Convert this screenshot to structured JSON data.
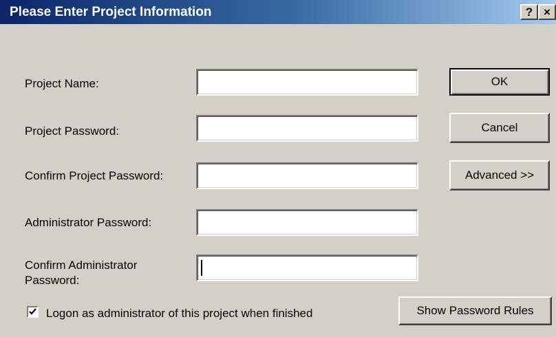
{
  "dialog": {
    "title": "Please Enter Project Information",
    "help_label": "?",
    "close_label": "×"
  },
  "fields": {
    "project_name": {
      "label": "Project Name:",
      "value": ""
    },
    "project_password": {
      "label": "Project Password:",
      "value": ""
    },
    "confirm_project_password": {
      "label": "Confirm Project Password:",
      "value": ""
    },
    "administrator_password": {
      "label": "Administrator Password:",
      "value": ""
    },
    "confirm_administrator_password": {
      "label_line1": "Confirm Administrator",
      "label_line2": "Password:",
      "value": ""
    }
  },
  "buttons": {
    "ok": "OK",
    "cancel": "Cancel",
    "advanced": "Advanced >>",
    "show_password_rules": "Show Password Rules"
  },
  "logon_checkbox": {
    "label": "Logon as administrator of this project when finished",
    "checked": true
  },
  "colors": {
    "titlebar_start": "#0a246a",
    "titlebar_end": "#a6caf0",
    "dialog_background": "#d4d0c8"
  }
}
